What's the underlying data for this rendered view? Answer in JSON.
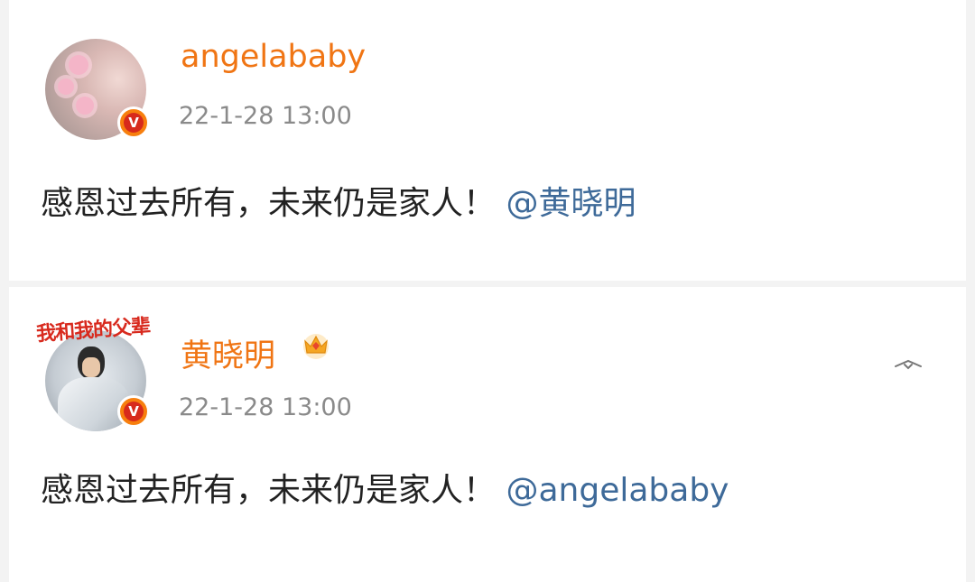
{
  "posts": [
    {
      "username": "angelababy",
      "timestamp": "22-1-28 13:00",
      "content": "感恩过去所有，未来仍是家人！",
      "mention": "@黄晓明",
      "badge_glyph": "V"
    },
    {
      "username": "黄晓明",
      "timestamp": "22-1-28 13:00",
      "content": "感恩过去所有，未来仍是家人！",
      "mention": "@angelababy",
      "badge_glyph": "V",
      "avatar_text": "我和我的父辈"
    }
  ],
  "colors": {
    "username": "#f07514",
    "mention": "#3e6a99",
    "timestamp": "#8a8a8a",
    "text": "#222222",
    "badge_outer": "#f77f0e",
    "badge_inner": "#d72a1c"
  },
  "icons": {
    "verified": "verified-badge-icon",
    "crown": "crown-icon",
    "menu": "chevron-down-icon"
  }
}
